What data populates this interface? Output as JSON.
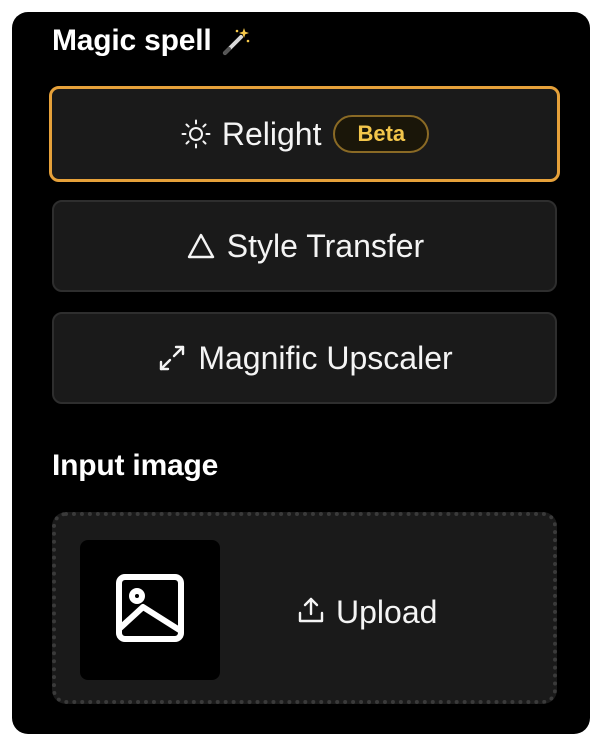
{
  "magic_spell": {
    "title": "Magic spell",
    "icon": "magic-wand-icon",
    "options": [
      {
        "label": "Relight",
        "icon": "sun-icon",
        "badge": "Beta",
        "selected": true
      },
      {
        "label": "Style Transfer",
        "icon": "triangle-icon",
        "selected": false
      },
      {
        "label": "Magnific Upscaler",
        "icon": "expand-arrows-icon",
        "selected": false
      }
    ]
  },
  "input_image": {
    "title": "Input image",
    "placeholder_icon": "image-icon",
    "upload_label": "Upload",
    "upload_icon": "upload-icon"
  },
  "colors": {
    "panel_bg": "#000000",
    "button_bg": "#1a1a1a",
    "button_border": "#2e2e2e",
    "selected_border": "#e6a13a",
    "badge_text": "#f3c64b",
    "text": "#f4f4f4"
  }
}
